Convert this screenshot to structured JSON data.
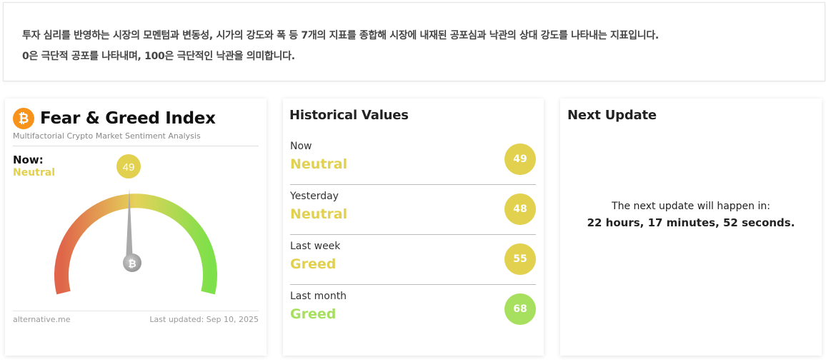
{
  "description": {
    "line1": "투자 심리를 반영하는 시장의 모멘텀과 변동성, 시가의 강도와 폭 등 7개의 지표를 종합해 시장에 내재된 공포심과 낙관의 상대 강도를 나타내는 지표입니다.",
    "line2": "0은 극단적 공포를 나타내며, 100은 극단적인 낙관을 의미합니다."
  },
  "fear_greed": {
    "title": "Fear & Greed Index",
    "subtitle": "Multifactorial Crypto Market Sentiment Analysis",
    "logo_icon": "bitcoin-icon",
    "now_label": "Now:",
    "now_status": "Neutral",
    "value": 49,
    "value_label": "49",
    "source": "alternative.me",
    "last_updated": "Last updated: Sep 10, 2025"
  },
  "historical": {
    "title": "Historical Values",
    "rows": [
      {
        "label": "Now",
        "status": "Neutral",
        "value": "49",
        "color": "#e2d04f",
        "status_color": "#e2d04f"
      },
      {
        "label": "Yesterday",
        "status": "Neutral",
        "value": "48",
        "color": "#e2d04f",
        "status_color": "#e2d04f"
      },
      {
        "label": "Last week",
        "status": "Greed",
        "value": "55",
        "color": "#e2d04f",
        "status_color": "#e2d04f"
      },
      {
        "label": "Last month",
        "status": "Greed",
        "value": "68",
        "color": "#a6e05e",
        "status_color": "#a6e05e"
      }
    ]
  },
  "next_update": {
    "title": "Next Update",
    "text": "The next update will happen in:",
    "countdown": "22 hours, 17 minutes, 52 seconds."
  },
  "colors": {
    "neutral": "#e2d04f",
    "greed": "#a6e05e",
    "fear": "#e0654a",
    "bitcoin": "#f7931a"
  }
}
